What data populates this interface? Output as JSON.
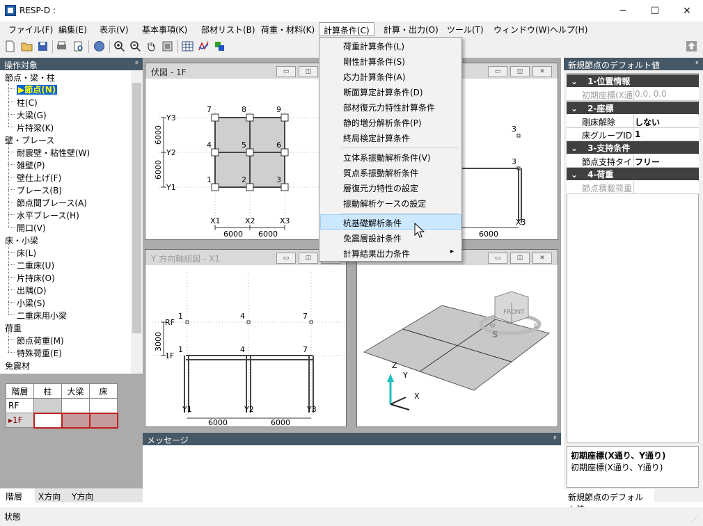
{
  "window": {
    "title": "RESP-D :",
    "controls": [
      "─",
      "☐",
      "✕"
    ]
  },
  "menubar": [
    "ファイル(F)",
    "編集(E)",
    "表示(V)",
    "基本事項(K)",
    "部材リスト(B)",
    "荷重・材料(K)",
    "計算条件(C)",
    "計算・出力(O)",
    "ツール(T)",
    "ウィンドウ(W)",
    "ヘルプ(H)"
  ],
  "dropdown": {
    "group1": [
      "荷重計算条件(L)",
      "剛性計算条件(S)",
      "応力計算条件(A)",
      "断面算定計算条件(D)",
      "部材復元力特性計算条件",
      "静的増分解析条件(P)",
      "終局検定計算条件"
    ],
    "group2": [
      "立体系振動解析条件(V)",
      "質点系振動解析条件",
      "層復元力特性の設定",
      "振動解析ケースの設定"
    ],
    "group3": [
      "杭基礎解析条件",
      "免震層設計条件",
      "計算結果出力条件"
    ],
    "submenu_arrow": "▸"
  },
  "left_panel": {
    "title": "操作対象",
    "pin": "ᵖ",
    "tree": [
      {
        "cat": "節点・梁・柱",
        "items": [
          "節点(N)",
          "柱(C)",
          "大梁(G)",
          "片持梁(K)"
        ]
      },
      {
        "cat": "壁・ブレース",
        "items": [
          "耐震壁・粘性壁(W)",
          "雑壁(P)",
          "壁仕上げ(F)",
          "ブレース(B)",
          "節点間ブレース(A)",
          "水平ブレース(H)",
          "開口(V)"
        ]
      },
      {
        "cat": "床・小梁",
        "items": [
          "床(L)",
          "二重床(U)",
          "片持床(O)",
          "出隅(D)",
          "小梁(S)",
          "二重床用小梁"
        ]
      },
      {
        "cat": "荷重",
        "items": [
          "節点荷重(M)",
          "特殊荷重(E)"
        ]
      },
      {
        "cat": "免震材",
        "items": []
      }
    ],
    "selected_marker": "▶"
  },
  "floor_table": {
    "headers": [
      "階層",
      "柱",
      "大梁",
      "床"
    ],
    "rows": [
      [
        "RF",
        "",
        "",
        ""
      ],
      [
        "▸1F",
        "",
        "",
        ""
      ]
    ]
  },
  "bottom_tabs_left": [
    "階層",
    "X方向",
    "Y方向"
  ],
  "plan_view": {
    "title": "伏図 - 1F",
    "node_labels": [
      "7",
      "8",
      "9",
      "4",
      "5",
      "6",
      "1",
      "2",
      "3"
    ],
    "y_labels": [
      "Y3",
      "Y2",
      "Y1"
    ],
    "x_labels": [
      "X1",
      "X2",
      "X3"
    ],
    "spans": [
      "6000",
      "6000"
    ],
    "vspans": [
      "6000",
      "6000"
    ]
  },
  "x_frame_view": {
    "node_labels": [
      "3",
      "3"
    ],
    "span": "6000",
    "axis": "X3"
  },
  "y_frame_view": {
    "title": "Y 方向軸組図 - X1",
    "levels": [
      "RF",
      "1F"
    ],
    "top_nodes": [
      "1",
      "4",
      "7"
    ],
    "mid_nodes": [
      "1",
      "4",
      "7"
    ],
    "base_labels": [
      "Y1",
      "Y2",
      "Y3"
    ],
    "height": "3000",
    "spans": [
      "6000",
      "6000"
    ]
  },
  "view3d": {
    "axes": [
      "Z",
      "Y",
      "X"
    ],
    "cube": "FRONT",
    "compass": [
      "W",
      "S",
      "E"
    ]
  },
  "message_panel": {
    "title": "メッセージ",
    "pin": "ᵖ"
  },
  "right_panel": {
    "title": "新規節点のデフォルト値",
    "pin": "ᵖ",
    "groups": [
      {
        "name": "1-位置情報",
        "rows": [
          {
            "name": "初期座標(X通",
            "value": "0.0, 0.0",
            "disabled": true
          }
        ]
      },
      {
        "name": "2-座標",
        "rows": [
          {
            "name": "剛床解除",
            "value": "しない",
            "disabled": false
          },
          {
            "name": "床グループID",
            "value": "1",
            "disabled": false
          }
        ]
      },
      {
        "name": "3-支持条件",
        "rows": [
          {
            "name": "節点支持タイプ",
            "value": "フリー",
            "disabled": false
          }
        ]
      },
      {
        "name": "4-荷重",
        "rows": [
          {
            "name": "節点積載荷重",
            "value": "",
            "disabled": true
          }
        ]
      }
    ],
    "help_title": "初期座標(X通り、Y通り)",
    "help_text": "初期座標(X通り、Y通り)",
    "tab": "新規節点のデフォルト値"
  },
  "statusbar": {
    "text": "状態"
  }
}
